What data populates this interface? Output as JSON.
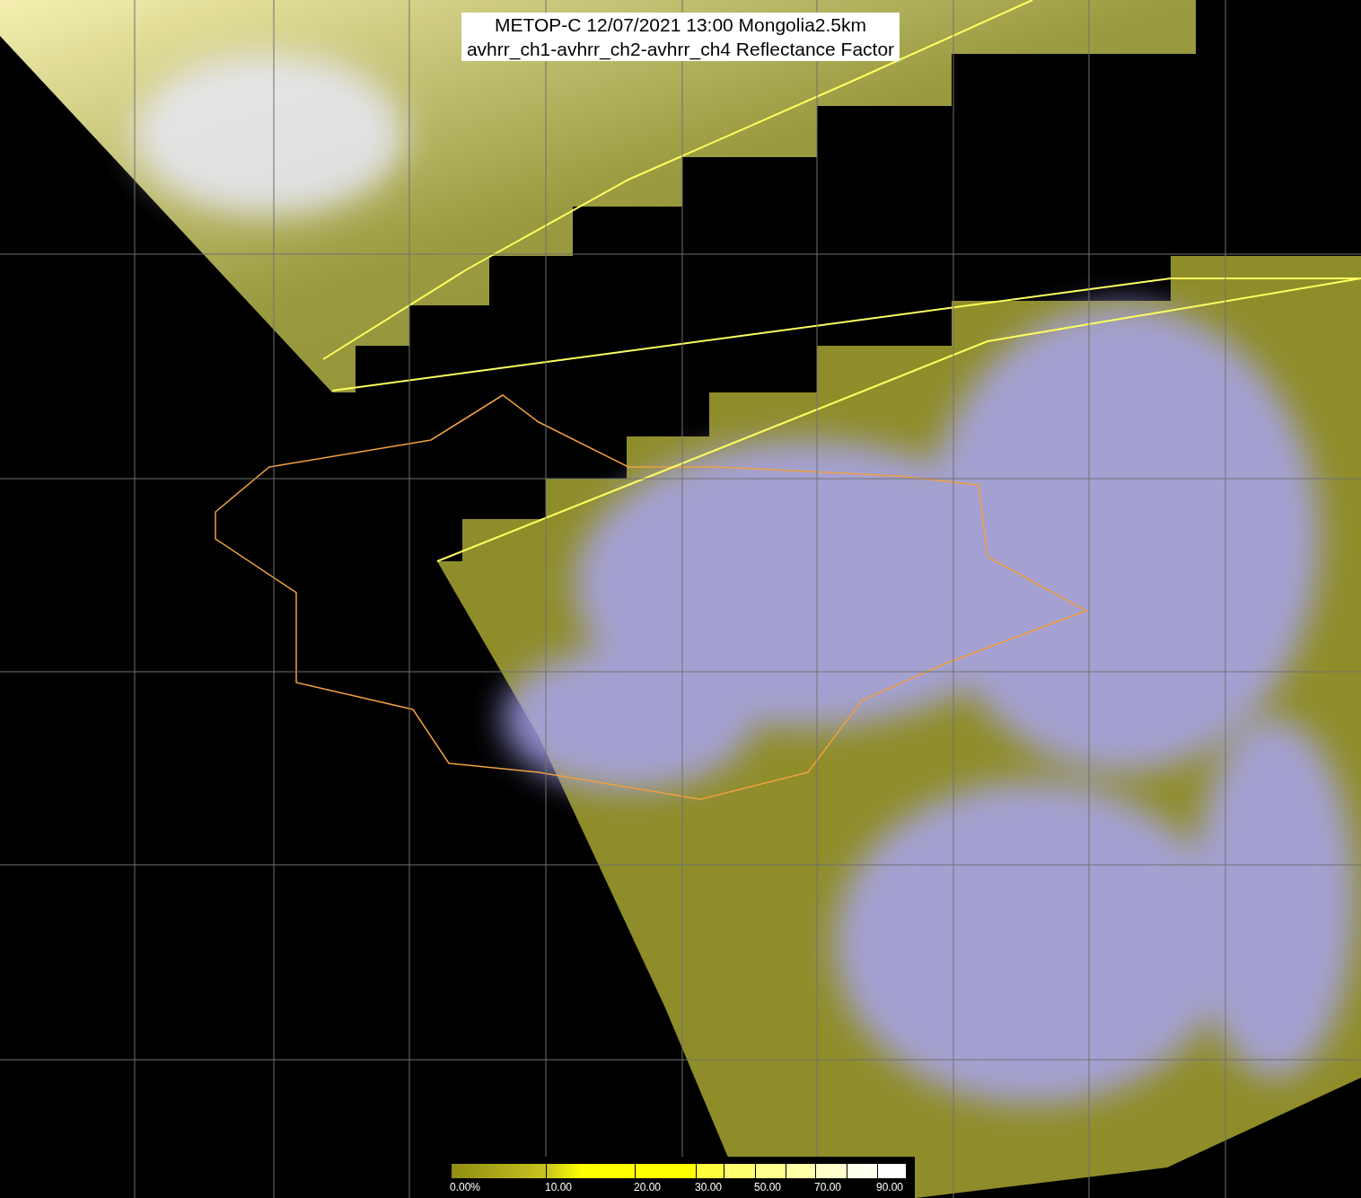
{
  "title": {
    "lines": [
      "METOP-C 12/07/2021 13:00 Mongolia2.5km",
      "avhrr_ch1-avhrr_ch2-avhrr_ch4 Reflectance Factor"
    ]
  },
  "colorbar": {
    "labels": [
      "0.00%",
      "10.00",
      "20.00",
      "30.00",
      "50.00",
      "70.00",
      "90.00"
    ]
  }
}
